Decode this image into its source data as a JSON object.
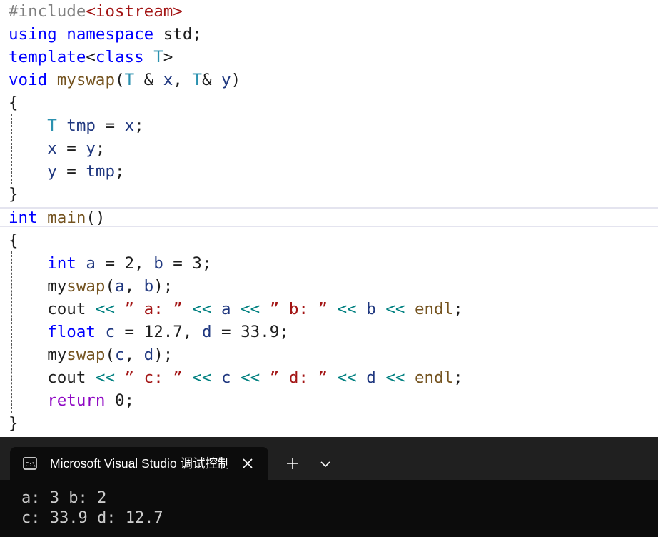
{
  "editor": {
    "code": {
      "l1_pp": "#include",
      "l1_inc": "<iostream>",
      "l2_using": "using",
      "l2_namespace": "namespace",
      "l2_rest": " std;",
      "l3_template": "template",
      "l3_lt": "<",
      "l3_class": "class",
      "l3_T": " T",
      "l3_gt": ">",
      "l4_void": "void",
      "l4_fn": "myswap",
      "l4_open": "(",
      "l4_T1": "T",
      "l4_amp1": " & ",
      "l4_x": "x",
      "l4_comma": ", ",
      "l4_T2": "T",
      "l4_amp2": "& ",
      "l4_y": "y",
      "l4_close": ")",
      "l5": "{",
      "l6_T": "T",
      "l6_tmp": " tmp",
      "l6_eq": " = ",
      "l6_x": "x",
      "l6_semi": ";",
      "l7_x": "x",
      "l7_eq": " = ",
      "l7_y": "y",
      "l7_semi": ";",
      "l8_y": "y",
      "l8_eq": " = ",
      "l8_tmp": "tmp",
      "l8_semi": ";",
      "l9": "}",
      "l10_int": "int",
      "l10_main": " main",
      "l10_paren": "()",
      "l11": "{",
      "l12_int": "int",
      "l12_a": " a",
      "l12_mid": " = 2, ",
      "l12_b": "b",
      "l12_end": " = 3;",
      "l13_my": "my",
      "l13_swap": "swap",
      "l13_open": "(",
      "l13_a": "a",
      "l13_comma": ", ",
      "l13_b": "b",
      "l13_close": ");",
      "l14_cout": "cout ",
      "l14_op1": "<<",
      "l14_s1": " ” a: ” ",
      "l14_op2": "<<",
      "l14_a": " a ",
      "l14_op3": "<<",
      "l14_s2": " ” b: ” ",
      "l14_op4": "<<",
      "l14_b": " b ",
      "l14_op5": "<<",
      "l14_endl": " endl",
      "l14_semi": ";",
      "l15_float": "float",
      "l15_c": " c",
      "l15_mid": " = 12.7, ",
      "l15_d": "d",
      "l15_end": " = 33.9;",
      "l16_my": "my",
      "l16_swap": "swap",
      "l16_open": "(",
      "l16_c": "c",
      "l16_comma": ", ",
      "l16_d": "d",
      "l16_close": ");",
      "l17_cout": "cout ",
      "l17_op1": "<<",
      "l17_s1": " ” c: ” ",
      "l17_op2": "<<",
      "l17_c": " c ",
      "l17_op3": "<<",
      "l17_s2": " ” d: ” ",
      "l17_op4": "<<",
      "l17_d": " d ",
      "l17_op5": "<<",
      "l17_endl": " endl",
      "l17_semi": ";",
      "l18_return": "return",
      "l18_rest": " 0;",
      "l19": "}"
    }
  },
  "console": {
    "tab_title": "Microsoft Visual Studio 调试控制台",
    "tab_icon": "console-icon",
    "output_line1": "a: 3 b: 2",
    "output_line2": "c: 33.9 d: 12.7"
  },
  "colors": {
    "keyword": "#0000ff",
    "type": "#2b91af",
    "function": "#74531f",
    "string": "#a31515",
    "operator": "#008080",
    "console_bg": "#0c0c0c",
    "titlebar_bg": "#202020"
  }
}
